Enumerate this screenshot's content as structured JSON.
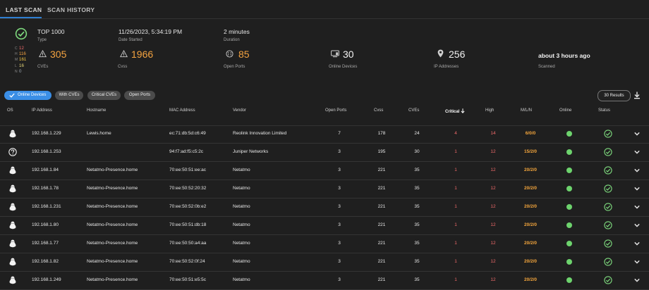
{
  "tabs": [
    {
      "label": "LAST SCAN",
      "active": true
    },
    {
      "label": "SCAN HISTORY",
      "active": false
    }
  ],
  "summary": {
    "status_icon": "check-circle-icon",
    "severity_counts": [
      {
        "key": "C",
        "value": "12",
        "color": "#f26b6b"
      },
      {
        "key": "H",
        "value": "116",
        "color": "#f4a340"
      },
      {
        "key": "M",
        "value": "161",
        "color": "#f4c542"
      },
      {
        "key": "L",
        "value": "16",
        "color": "#e8d77a"
      },
      {
        "key": "N",
        "value": "0",
        "color": "#9fa8b3"
      }
    ],
    "type": {
      "value": "TOP 1000",
      "label": "Type"
    },
    "date_started": {
      "value": "11/26/2023, 5:34:19 PM",
      "label": "Date Started"
    },
    "duration": {
      "value": "2 minutes",
      "label": "Duration"
    },
    "cves": {
      "value": "305",
      "label": "CVEs",
      "icon": "warning-icon"
    },
    "cvss": {
      "value": "1966",
      "label": "Cvss",
      "icon": "warning-icon"
    },
    "open_ports": {
      "value": "85",
      "label": "Open Ports",
      "icon": "ports-icon"
    },
    "online_devices": {
      "value": "30",
      "label": "Online Devices",
      "icon": "devices-icon"
    },
    "ip_addresses": {
      "value": "256",
      "label": "IP Addresses",
      "icon": "location-pin-icon"
    },
    "scanned": {
      "value": "about 3 hours ago",
      "label": "Scanned"
    }
  },
  "filters": {
    "pills": [
      {
        "label": "Online Devices",
        "active": true
      },
      {
        "label": "With CVEs",
        "active": false
      },
      {
        "label": "Critical CVEs",
        "active": false
      },
      {
        "label": "Open Ports",
        "active": false
      }
    ],
    "results": "30 Results"
  },
  "table": {
    "headers": {
      "os": "OS",
      "ip": "IP Address",
      "hostname": "Hostname",
      "mac": "MAC Address",
      "vendor": "Vendor",
      "open_ports": "Open Ports",
      "cvss": "Cvss",
      "cves": "CVEs",
      "critical": "Critical",
      "high": "High",
      "mln": "M/L/N",
      "online": "Online",
      "status": "Status"
    },
    "sort": {
      "column": "Critical",
      "direction": "descending"
    },
    "rows": [
      {
        "os": "linux-icon",
        "ip": "192.168.1.229",
        "hostname": "Lewis.home",
        "mac": "ec:71:db:5d:c6:49",
        "vendor": "Reolink Innovation Limited",
        "open_ports": "7",
        "cvss": "178",
        "cves": "24",
        "critical": "4",
        "high": "14",
        "mln": "6/0/0",
        "online": true,
        "status": "ok"
      },
      {
        "os": "unknown-os-icon",
        "ip": "192.168.1.253",
        "hostname": "",
        "mac": "94:f7:ad:f5:c5:2c",
        "vendor": "Juniper Networks",
        "open_ports": "3",
        "cvss": "195",
        "cves": "30",
        "critical": "1",
        "high": "12",
        "mln": "15/2/0",
        "online": true,
        "status": "ok"
      },
      {
        "os": "linux-icon",
        "ip": "192.168.1.84",
        "hostname": "Netatmo-Presence.home",
        "mac": "70:ee:50:51:ee:ac",
        "vendor": "Netatmo",
        "open_ports": "3",
        "cvss": "221",
        "cves": "35",
        "critical": "1",
        "high": "12",
        "mln": "20/2/0",
        "online": true,
        "status": "ok"
      },
      {
        "os": "linux-icon",
        "ip": "192.168.1.78",
        "hostname": "Netatmo-Presence.home",
        "mac": "70:ee:50:52:20:32",
        "vendor": "Netatmo",
        "open_ports": "3",
        "cvss": "221",
        "cves": "35",
        "critical": "1",
        "high": "12",
        "mln": "20/2/0",
        "online": true,
        "status": "ok"
      },
      {
        "os": "linux-icon",
        "ip": "192.168.1.231",
        "hostname": "Netatmo-Presence.home",
        "mac": "70:ee:50:52:0b:e2",
        "vendor": "Netatmo",
        "open_ports": "3",
        "cvss": "221",
        "cves": "35",
        "critical": "1",
        "high": "12",
        "mln": "20/2/0",
        "online": true,
        "status": "ok"
      },
      {
        "os": "linux-icon",
        "ip": "192.168.1.80",
        "hostname": "Netatmo-Presence.home",
        "mac": "70:ee:50:51:db:18",
        "vendor": "Netatmo",
        "open_ports": "3",
        "cvss": "221",
        "cves": "35",
        "critical": "1",
        "high": "12",
        "mln": "20/2/0",
        "online": true,
        "status": "ok"
      },
      {
        "os": "linux-icon",
        "ip": "192.168.1.77",
        "hostname": "Netatmo-Presence.home",
        "mac": "70:ee:50:50:a4:aa",
        "vendor": "Netatmo",
        "open_ports": "3",
        "cvss": "221",
        "cves": "35",
        "critical": "1",
        "high": "12",
        "mln": "20/2/0",
        "online": true,
        "status": "ok"
      },
      {
        "os": "linux-icon",
        "ip": "192.168.1.82",
        "hostname": "Netatmo-Presence.home",
        "mac": "70:ee:50:52:0f:24",
        "vendor": "Netatmo",
        "open_ports": "3",
        "cvss": "221",
        "cves": "35",
        "critical": "1",
        "high": "12",
        "mln": "20/2/0",
        "online": true,
        "status": "ok"
      },
      {
        "os": "linux-icon",
        "ip": "192.168.1.249",
        "hostname": "Netatmo-Presence.home",
        "mac": "70:ee:50:51:e5:5c",
        "vendor": "Netatmo",
        "open_ports": "3",
        "cvss": "221",
        "cves": "35",
        "critical": "1",
        "high": "12",
        "mln": "20/2/0",
        "online": true,
        "status": "ok"
      }
    ]
  },
  "colors": {
    "accent": "#3a8ee6",
    "orange": "#f4a340",
    "critical": "#f26b6b",
    "online": "#6dd36d",
    "ok": "#7dd87d"
  }
}
